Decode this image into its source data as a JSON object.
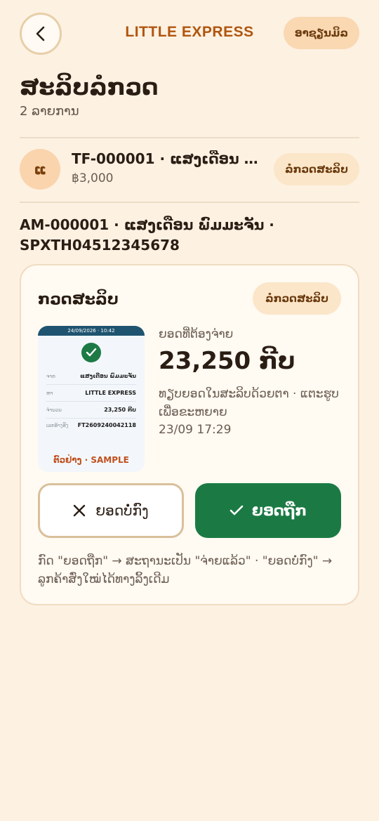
{
  "header": {
    "brand": "LITTLE EXPRESS",
    "help_label": "ອາຊຽນມິລ"
  },
  "page": {
    "title": "ສະລິບລໍກວດ",
    "count": "2 ລາຍການ"
  },
  "list": {
    "avatar": "ແ",
    "title": "TF-000001 · ແສງເດືອນ ພົມມ...",
    "amount": "฿3,000",
    "action": "ລໍກວດສະລິບ"
  },
  "order": {
    "heading": "AM-000001 · ແສງເດືອນ ພົມມະຈັນ · SPXTH04512345678"
  },
  "review": {
    "title": "ກວດສະລິບ",
    "status": "ລໍກວດສະລິບ",
    "due_label": "ຍອດທີ່ຕ້ອງຈ່າຍ",
    "due_amount": "23,250 ກີບ",
    "hint": "ທຽບຍອດໃນສະລິບດ້ວຍຕາ · ແຕະຮູບເພື່ອຂະຫຍາຍ",
    "timestamp": "23/09 17:29",
    "reject_label": "ຍອດບໍ່ກົງ",
    "approve_label": "ຍອດຖືກ",
    "footnote": "ກົດ \"ຍອດຖືກ\" → ສະຖານະເປັນ \"ຈ່າຍແລ້ວ\" · \"ຍອດບໍ່ກົງ\" → ລູກຄ້າສົ່ງໃໝ່ໄດ້ທາງລິ້ງເດີມ"
  },
  "slip": {
    "datetime": "24/09/2026 · 10:42",
    "rows": [
      {
        "k": "ຈາກ",
        "v": "ແສງເດືອນ ພົມມະຈັນ"
      },
      {
        "k": "ຫາ",
        "v": "LITTLE EXPRESS"
      },
      {
        "k": "ຈຳນວນ",
        "v": "23,250 ກີບ"
      },
      {
        "k": "ເລກອ້າງອີງ",
        "v": "FT2609240042118"
      }
    ],
    "sample": "ຕົວຢ່າງ · SAMPLE"
  },
  "colors": {
    "background": "#fdf1e2",
    "brand": "#b0560f",
    "approve": "#1b7a44"
  }
}
